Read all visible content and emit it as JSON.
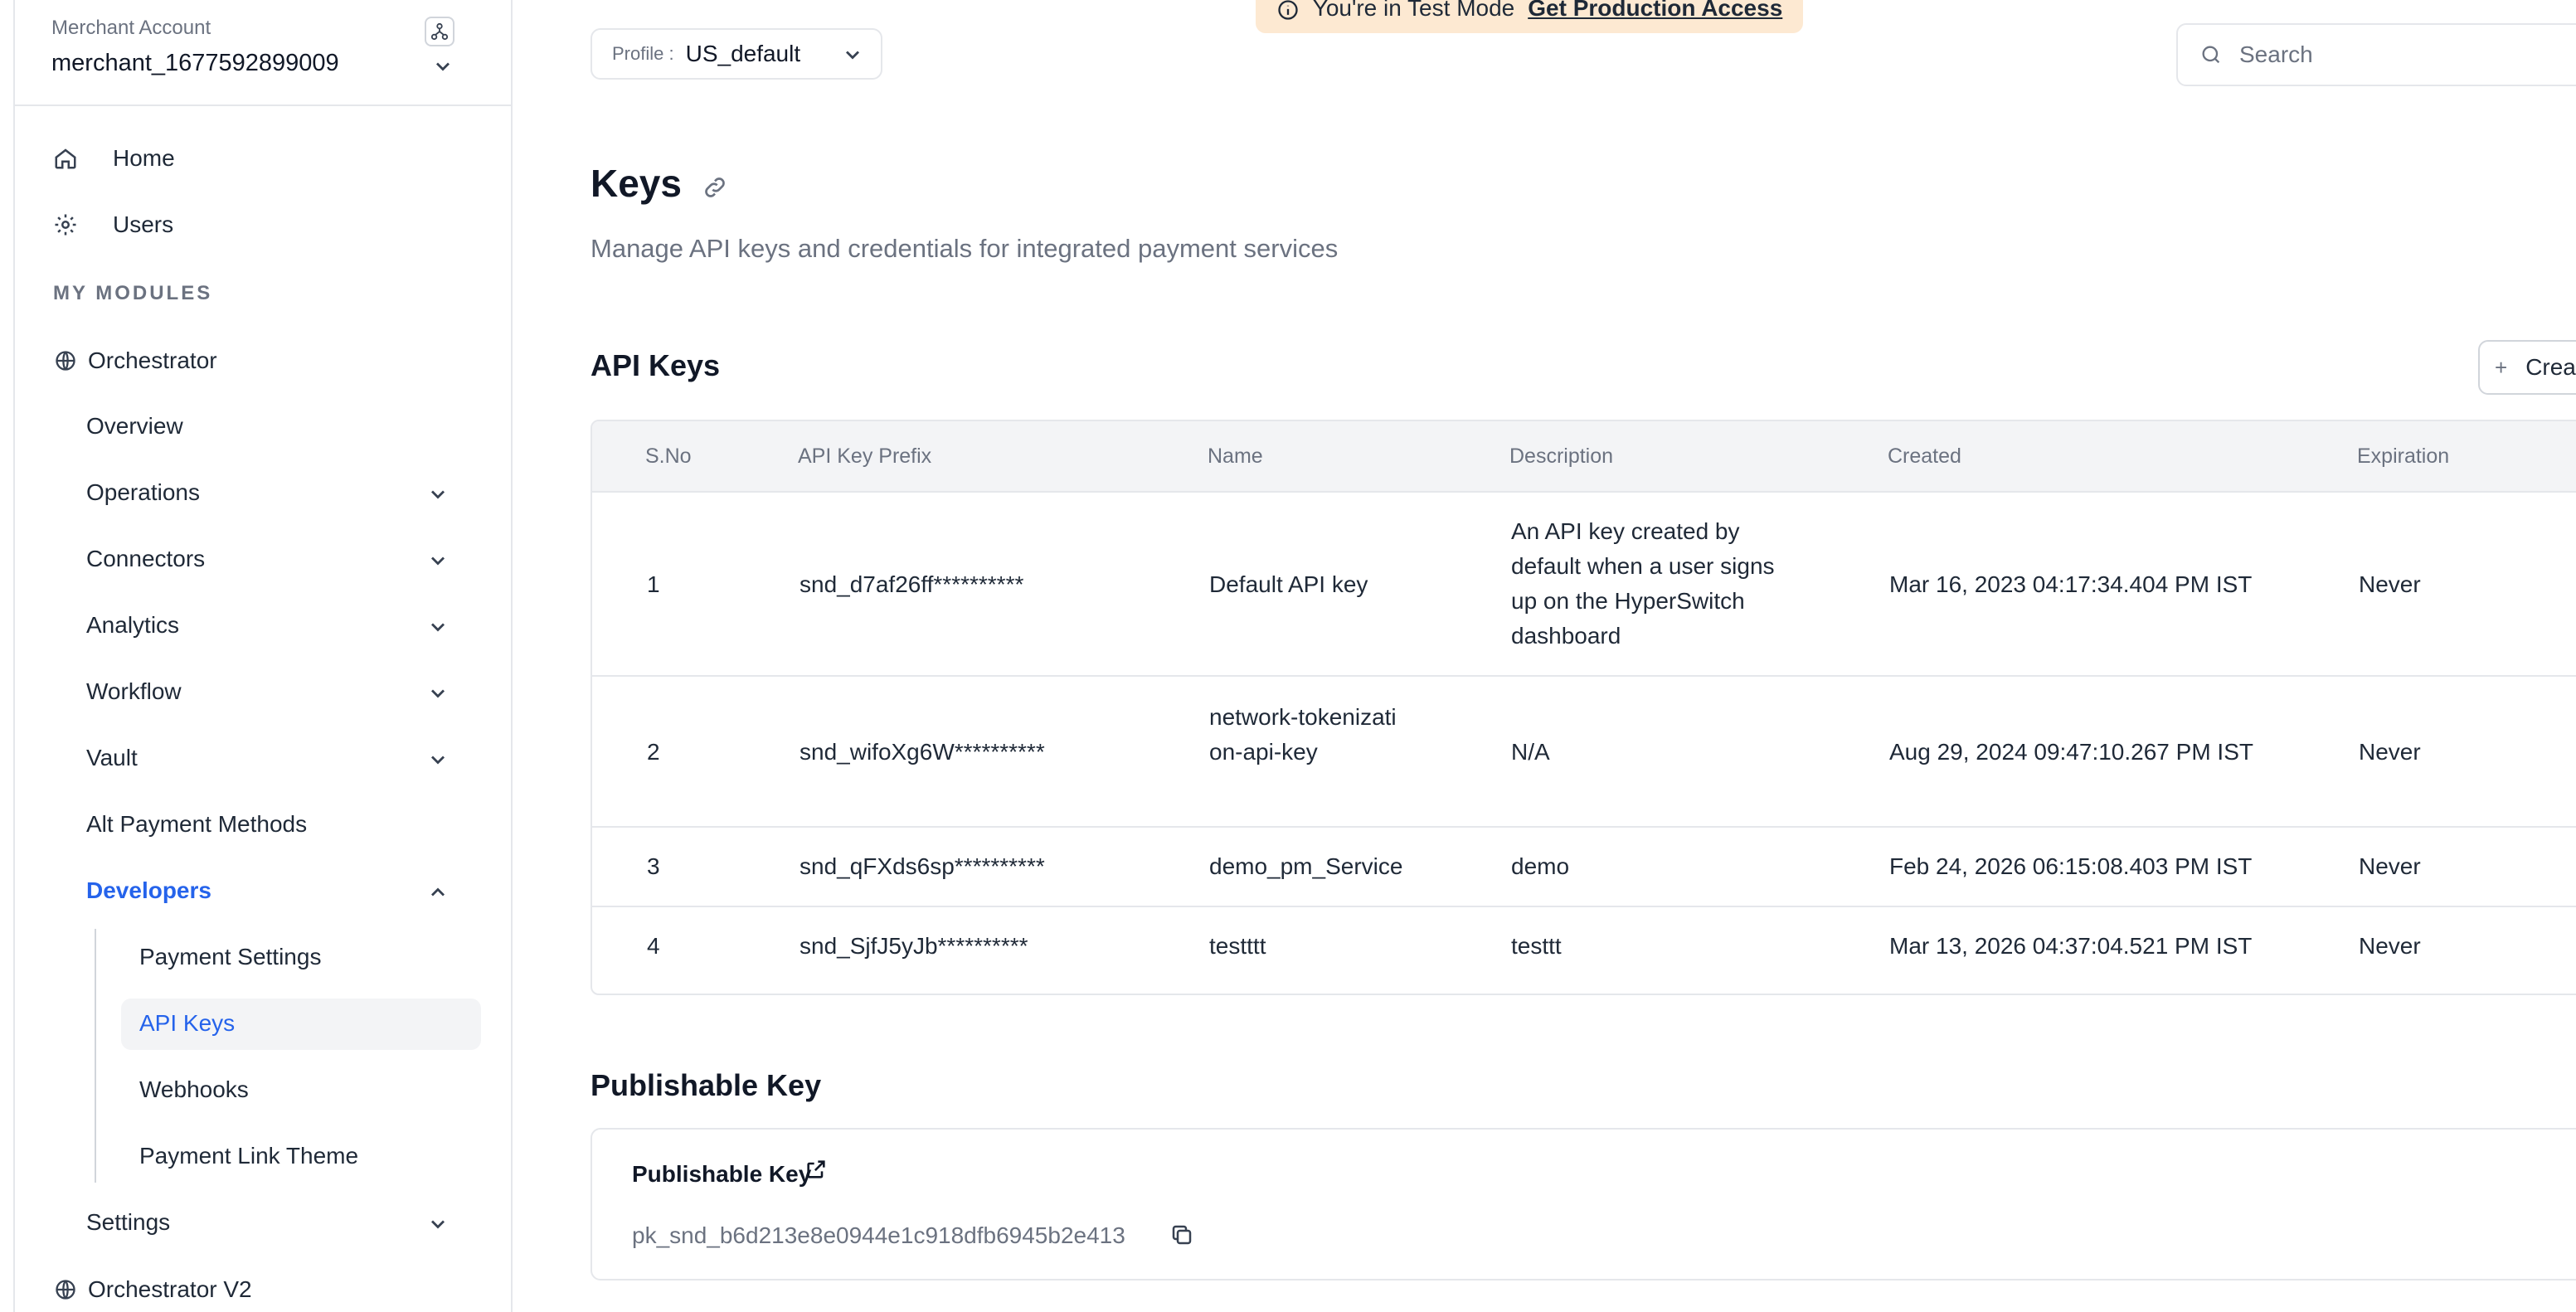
{
  "merchant": {
    "label": "Merchant Account",
    "id": "merchant_1677592899009"
  },
  "sidebar": {
    "top_items": [
      {
        "label": "Home",
        "icon": "home-icon"
      },
      {
        "label": "Users",
        "icon": "gear-icon"
      }
    ],
    "section_title": "MY MODULES",
    "orchestrator": {
      "label": "Orchestrator",
      "icon": "globe-icon"
    },
    "items": [
      {
        "label": "Overview"
      },
      {
        "label": "Operations"
      },
      {
        "label": "Connectors"
      },
      {
        "label": "Analytics"
      },
      {
        "label": "Workflow"
      },
      {
        "label": "Vault"
      },
      {
        "label": "Alt Payment Methods"
      },
      {
        "label": "Developers"
      }
    ],
    "developer_sub": [
      {
        "label": "Payment Settings"
      },
      {
        "label": "API Keys"
      },
      {
        "label": "Webhooks"
      },
      {
        "label": "Payment Link Theme"
      }
    ],
    "settings": {
      "label": "Settings"
    },
    "orchestrator_v2": {
      "label": "Orchestrator V2",
      "icon": "globe-icon"
    }
  },
  "topbar": {
    "profile_label": "Profile :",
    "profile_value": "US_default",
    "test_mode_text": "You're in Test Mode",
    "test_mode_link": "Get Production Access",
    "search_placeholder": "Search"
  },
  "page": {
    "title": "Keys",
    "subtitle": "Manage API keys and credentials for integrated payment services"
  },
  "api_keys": {
    "heading": "API Keys",
    "create_label": "Create New API Key",
    "columns": [
      "S.No",
      "API Key Prefix",
      "Name",
      "Description",
      "Created",
      "Expiration"
    ],
    "rows": [
      {
        "sno": "1",
        "prefix": "snd_d7af26ff**********",
        "name": "Default API key",
        "description": "An API key created by default when a user signs up on the HyperSwitch dashboard",
        "created": "Mar 16, 2023 04:17:34.404 PM IST",
        "expiration": "Never"
      },
      {
        "sno": "2",
        "prefix": "snd_wifoXg6W**********",
        "name": "network-tokenization-api-key",
        "description": "N/A",
        "created": "Aug 29, 2024 09:47:10.267 PM IST",
        "expiration": "Never"
      },
      {
        "sno": "3",
        "prefix": "snd_qFXds6sp**********",
        "name": "demo_pm_Service",
        "description": "demo",
        "created": "Feb 24, 2026 06:15:08.403 PM IST",
        "expiration": "Never"
      },
      {
        "sno": "4",
        "prefix": "snd_SjfJ5yJb**********",
        "name": "testttt",
        "description": "testtt",
        "created": "Mar 13, 2026 04:37:04.521 PM IST",
        "expiration": "Never"
      }
    ]
  },
  "publishable": {
    "heading": "Publishable Key",
    "card_title": "Publishable Key",
    "value": "pk_snd_b6d213e8e0944e1c918dfb6945b2e413"
  },
  "colors": {
    "accent": "#2563eb",
    "banner": "#fde9d2",
    "text_muted": "#6b7280"
  }
}
